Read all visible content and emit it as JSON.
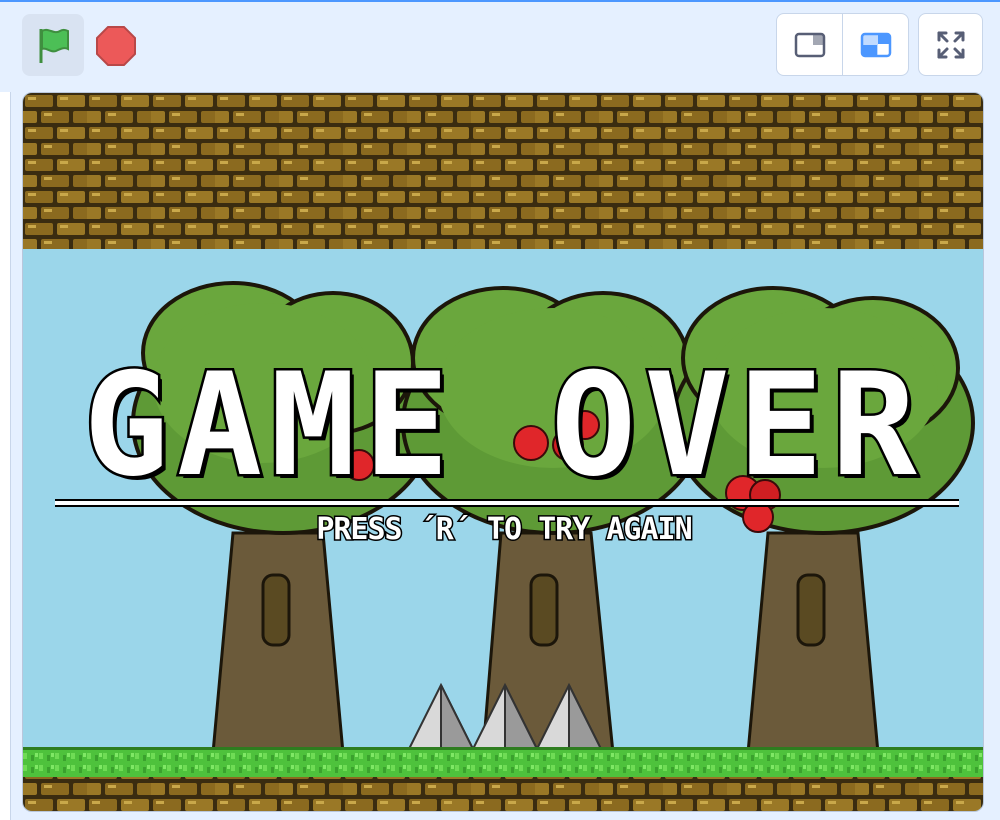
{
  "toolbar": {
    "green_flag_icon": "green-flag-icon",
    "stop_icon": "stop-sign-icon",
    "small_stage_icon": "small-stage-icon",
    "large_stage_icon": "large-stage-icon",
    "fullscreen_icon": "fullscreen-icon"
  },
  "colors": {
    "accent": "#4c97ff",
    "flag_green": "#4cbf56",
    "stop_red": "#ec5959",
    "sky": "#9bd6ea",
    "brick": "#8b6a1f",
    "grass": "#4ec23c"
  },
  "stage": {
    "title": "GAME OVER",
    "subtitle": "PRESS ´R´ TO TRY AGAIN"
  }
}
